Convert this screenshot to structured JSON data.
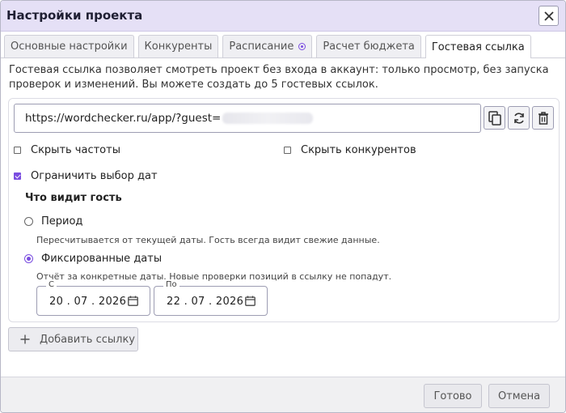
{
  "dialog": {
    "title": "Настройки проекта",
    "close_icon": "close-icon"
  },
  "tabs": [
    {
      "label": "Основные настройки",
      "active": false
    },
    {
      "label": "Конкуренты",
      "active": false
    },
    {
      "label": "Расписание",
      "active": false,
      "badge_icon": "radio-dot-icon"
    },
    {
      "label": "Расчет бюджета",
      "active": false
    },
    {
      "label": "Гостевая ссылка",
      "active": true
    }
  ],
  "guest_link": {
    "description": "Гостевая ссылка позволяет смотреть проект без входа в аккаунт: только просмотр, без запуска проверок и изменений. Вы можете создать до 5 гостевых ссылок.",
    "url_prefix": "https://wordchecker.ru/app/?guest=",
    "actions": {
      "copy_icon": "copy-icon",
      "refresh_icon": "refresh-icon",
      "delete_icon": "trash-icon"
    },
    "options": {
      "hide_frequencies": {
        "label": "Скрыть частоты",
        "checked": false
      },
      "hide_competitors": {
        "label": "Скрыть конкурентов",
        "checked": false
      },
      "limit_dates": {
        "label": "Ограничить выбор дат",
        "checked": true
      }
    },
    "visibility": {
      "title": "Что видит гость",
      "period": {
        "label": "Период",
        "hint": "Пересчитывается от текущей даты. Гость всегда видит свежие данные.",
        "selected": false
      },
      "fixed": {
        "label": "Фиксированные даты",
        "hint": "Отчёт за конкретные даты. Новые проверки позиций в ссылку не попадут.",
        "selected": true
      },
      "date_from": {
        "label": "С",
        "value": "20 . 07 . 2026"
      },
      "date_to": {
        "label": "По",
        "value": "22 . 07 . 2026"
      }
    },
    "add_button": "Добавить ссылку"
  },
  "footer": {
    "done": "Готово",
    "cancel": "Отмена"
  },
  "colors": {
    "accent": "#7a4de0",
    "titlebar": "#e5e0f6"
  }
}
